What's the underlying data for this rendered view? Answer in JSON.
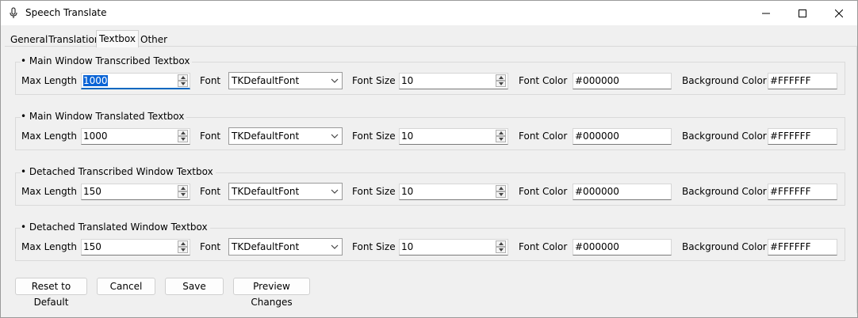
{
  "window": {
    "title": "Speech Translate",
    "icon": "microphone-icon"
  },
  "tabs": [
    {
      "label": "General",
      "selected": false
    },
    {
      "label": "Translation",
      "selected": false
    },
    {
      "label": "Textbox",
      "selected": true
    },
    {
      "label": "Other",
      "selected": false
    }
  ],
  "labels": {
    "max_length": "Max Length",
    "font": "Font",
    "font_size": "Font Size",
    "font_color": "Font Color",
    "background_color": "Background Color"
  },
  "groups": [
    {
      "title": "• Main Window Transcribed Textbox",
      "max_length": "1000",
      "font": "TKDefaultFont",
      "font_size": "10",
      "font_color": "#000000",
      "background_color": "#FFFFFF"
    },
    {
      "title": "• Main Window Translated Textbox",
      "max_length": "1000",
      "font": "TKDefaultFont",
      "font_size": "10",
      "font_color": "#000000",
      "background_color": "#FFFFFF"
    },
    {
      "title": "• Detached Transcribed Window Textbox",
      "max_length": "150",
      "font": "TKDefaultFont",
      "font_size": "10",
      "font_color": "#000000",
      "background_color": "#FFFFFF"
    },
    {
      "title": "• Detached Translated Window Textbox",
      "max_length": "150",
      "font": "TKDefaultFont",
      "font_size": "10",
      "font_color": "#000000",
      "background_color": "#FFFFFF"
    }
  ],
  "buttons": {
    "reset": "Reset to Default",
    "cancel": "Cancel",
    "save": "Save",
    "preview": "Preview Changes"
  },
  "colors": {
    "selection": "#0A64D6",
    "focus_underline": "#0067C0"
  }
}
